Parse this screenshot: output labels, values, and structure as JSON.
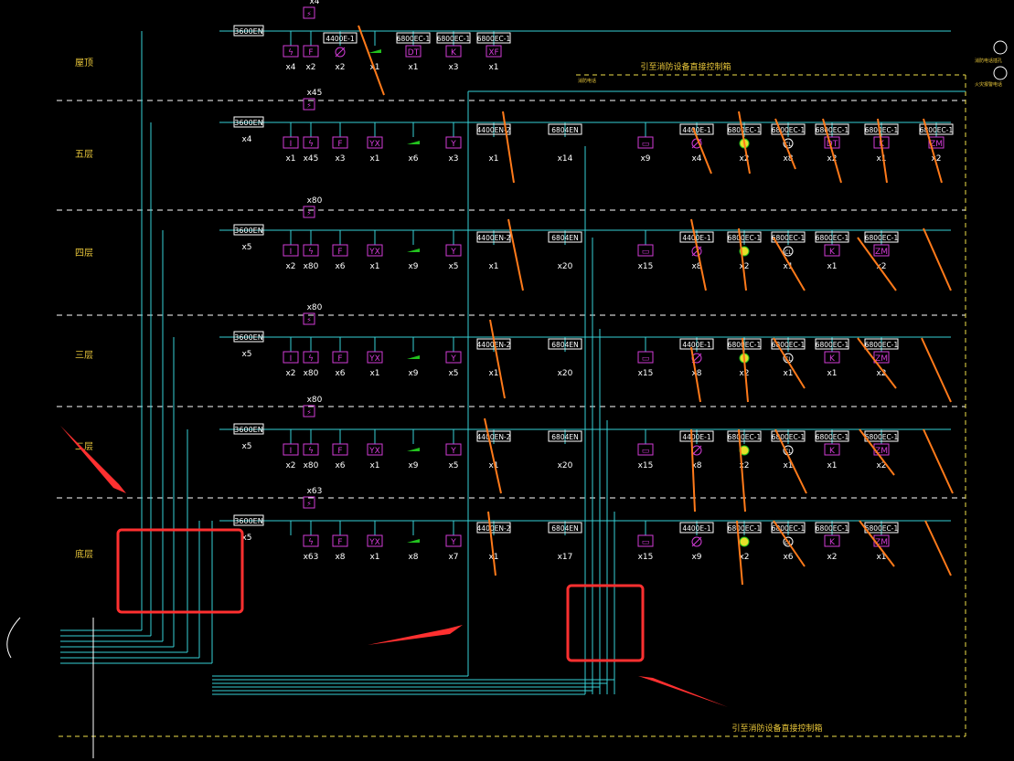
{
  "diagram": {
    "colors": {
      "background": "#000000",
      "wire": "#36d1d6",
      "device": "#d23cd6",
      "label": "#ffffff",
      "floor_label": "#e8c63a",
      "annotation_box": "#f0e14a",
      "dashed": "#f0e14a",
      "red_mark": "#ff3030",
      "orange_mark": "#ff7a1a",
      "green": "#22c11e"
    },
    "floors": [
      {
        "name": "屋顶",
        "bus_box": "3600EN",
        "bus_count": "",
        "top_module": "x4",
        "devices": [
          {
            "sym": "ϟ",
            "count": "x4"
          },
          {
            "sym": "F",
            "count": "x2"
          },
          {
            "box": "4400E-1",
            "sym": "Ø",
            "count": "x2"
          },
          {
            "sym": "green",
            "count": "x1"
          },
          {
            "box": "6800EC-1",
            "sub": "DT",
            "count": "x1"
          },
          {
            "box": "6800EC-1",
            "sub": "K",
            "count": "x3"
          },
          {
            "box": "6800EC-1",
            "sub": "XF",
            "count": "x1"
          }
        ]
      },
      {
        "name": "五层",
        "bus_box": "3600EN",
        "bus_count": "x4",
        "top_module": "x45",
        "devices": [
          {
            "sym": "I",
            "count": "x1"
          },
          {
            "sym": "ϟ",
            "count": "x45"
          },
          {
            "sym": "F",
            "count": "x3"
          },
          {
            "sym": "YX",
            "count": "x1"
          },
          {
            "sym": "green",
            "count": "x6"
          },
          {
            "sym": "Y",
            "count": "x3"
          },
          {
            "box": "4400EN-2",
            "count": "x1",
            "count2": "x1"
          },
          {
            "box": "6804EN",
            "count": "x14"
          },
          {
            "sym": "▭",
            "count": "x9"
          },
          {
            "box": "4400E-1",
            "sym": "Ø",
            "count": "x4"
          },
          {
            "box": "6800EC-1",
            "sym": "yellow",
            "count": "x2"
          },
          {
            "box": "6800EC-1",
            "sym": "CL",
            "count": "x8"
          },
          {
            "box": "6800EC-1",
            "sub": "DT",
            "count": "x2"
          },
          {
            "box": "6800EC-1",
            "sub": "K",
            "count": "x1"
          },
          {
            "box": "6800EC-1",
            "sub": "ZM",
            "count": "x2"
          }
        ]
      },
      {
        "name": "四层",
        "bus_box": "3600EN",
        "bus_count": "x5",
        "top_module": "x80",
        "devices": [
          {
            "sym": "I",
            "count": "x2"
          },
          {
            "sym": "ϟ",
            "count": "x80"
          },
          {
            "sym": "F",
            "count": "x6"
          },
          {
            "sym": "YX",
            "count": "x1"
          },
          {
            "sym": "green",
            "count": "x9"
          },
          {
            "sym": "Y",
            "count": "x5"
          },
          {
            "box": "4400EN-2",
            "count": "x1",
            "count2": "x1"
          },
          {
            "box": "6804EN",
            "count": "x20"
          },
          {
            "sym": "▭",
            "count": "x15"
          },
          {
            "box": "4400E-1",
            "sym": "Ø",
            "count": "x8"
          },
          {
            "box": "6800EC-1",
            "sym": "yellow",
            "count": "x2"
          },
          {
            "box": "6800EC-1",
            "sym": "CL",
            "count": "x1"
          },
          {
            "box": "6800EC-1",
            "sub": "K",
            "count": "x1"
          },
          {
            "box": "6800EC-1",
            "sub": "ZM",
            "count": "x2"
          }
        ]
      },
      {
        "name": "三层",
        "bus_box": "3600EN",
        "bus_count": "x5",
        "top_module": "x80",
        "devices": [
          {
            "sym": "I",
            "count": "x2"
          },
          {
            "sym": "ϟ",
            "count": "x80"
          },
          {
            "sym": "F",
            "count": "x6"
          },
          {
            "sym": "YX",
            "count": "x1"
          },
          {
            "sym": "green",
            "count": "x9"
          },
          {
            "sym": "Y",
            "count": "x5"
          },
          {
            "box": "4400EN-2",
            "count": "x1",
            "count2": "x1"
          },
          {
            "box": "6804EN",
            "count": "x20"
          },
          {
            "sym": "▭",
            "count": "x15"
          },
          {
            "box": "4400E-1",
            "sym": "Ø",
            "count": "x8"
          },
          {
            "box": "6800EC-1",
            "sym": "yellow",
            "count": "x2"
          },
          {
            "box": "6800EC-1",
            "sym": "CL",
            "count": "x1"
          },
          {
            "box": "6800EC-1",
            "sub": "K",
            "count": "x1"
          },
          {
            "box": "6800EC-1",
            "sub": "ZM",
            "count": "x2"
          }
        ]
      },
      {
        "name": "二层",
        "bus_box": "3600EN",
        "bus_count": "x5",
        "top_module": "x80",
        "devices": [
          {
            "sym": "I",
            "count": "x2"
          },
          {
            "sym": "ϟ",
            "count": "x80"
          },
          {
            "sym": "F",
            "count": "x6"
          },
          {
            "sym": "YX",
            "count": "x1"
          },
          {
            "sym": "green",
            "count": "x9"
          },
          {
            "sym": "Y",
            "count": "x5"
          },
          {
            "box": "4400EN-2",
            "count": "x1",
            "count2": "x1"
          },
          {
            "box": "6804EN",
            "count": "x20"
          },
          {
            "sym": "▭",
            "count": "x15"
          },
          {
            "box": "4400E-1",
            "sym": "Ø",
            "count": "x8"
          },
          {
            "box": "6800EC-1",
            "sym": "yellow",
            "count": "x2"
          },
          {
            "box": "6800EC-1",
            "sym": "CL",
            "count": "x1"
          },
          {
            "box": "6800EC-1",
            "sub": "K",
            "count": "x1"
          },
          {
            "box": "6800EC-1",
            "sub": "ZM",
            "count": "x2"
          }
        ]
      },
      {
        "name": "底层",
        "bus_box": "3600EN",
        "bus_count": "x5",
        "top_module": "x63",
        "devices": [
          {
            "sym": "",
            "count": ""
          },
          {
            "sym": "ϟ",
            "count": "x63"
          },
          {
            "sym": "F",
            "count": "x8"
          },
          {
            "sym": "YX",
            "count": "x1"
          },
          {
            "sym": "green",
            "count": "x8"
          },
          {
            "sym": "Y",
            "count": "x7"
          },
          {
            "box": "4400EN-2",
            "count": "x1",
            "count2": "x1"
          },
          {
            "box": "6804EN",
            "count": "x17"
          },
          {
            "sym": "▭",
            "count": "x15"
          },
          {
            "box": "4400E-1",
            "sym": "Ø",
            "count": "x9"
          },
          {
            "box": "6800EC-1",
            "sym": "yellow",
            "count": "x2"
          },
          {
            "box": "6800EC-1",
            "sym": "CL",
            "count": "x6"
          },
          {
            "box": "6800EC-1",
            "sub": "K",
            "count": "x2"
          },
          {
            "box": "6800EC-1",
            "sub": "ZM",
            "count": "x1"
          }
        ]
      }
    ],
    "annotations": {
      "top_right": "引至消防设备直接控制箱",
      "bottom": "引至消防设备直接控制箱",
      "phone1": "消防电话插孔",
      "phone2": "火灾报警电话",
      "fire_box_label": "消防电话"
    }
  }
}
